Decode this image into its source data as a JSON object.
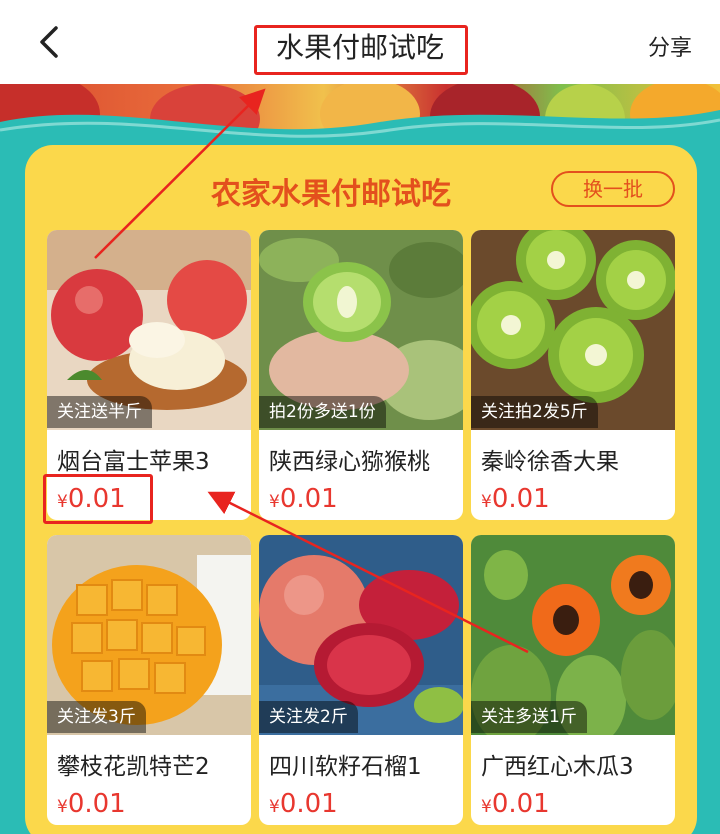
{
  "header": {
    "title": "水果付邮试吃",
    "share_label": "分享"
  },
  "panel": {
    "title": "农家水果付邮试吃",
    "swap_label": "换一批"
  },
  "products": [
    {
      "tag": "关注送半斤",
      "name": "烟台富士苹果3",
      "currency": "¥",
      "price": "0.01"
    },
    {
      "tag": "拍2份多送1份",
      "name": "陕西绿心猕猴桃",
      "currency": "¥",
      "price": "0.01"
    },
    {
      "tag": "关注拍2发5斤",
      "name": "秦岭徐香大果",
      "currency": "¥",
      "price": "0.01"
    },
    {
      "tag": "关注发3斤",
      "name": "攀枝花凯特芒2",
      "currency": "¥",
      "price": "0.01"
    },
    {
      "tag": "关注发2斤",
      "name": "四川软籽石榴1",
      "currency": "¥",
      "price": "0.01"
    },
    {
      "tag": "关注多送1斤",
      "name": "广西红心木瓜3",
      "currency": "¥",
      "price": "0.01"
    }
  ],
  "colors": {
    "accent": "#e3501d",
    "price": "#e8372f",
    "panel": "#fbd84b",
    "background": "#2bbcb5",
    "annotation": "#e8241f"
  }
}
